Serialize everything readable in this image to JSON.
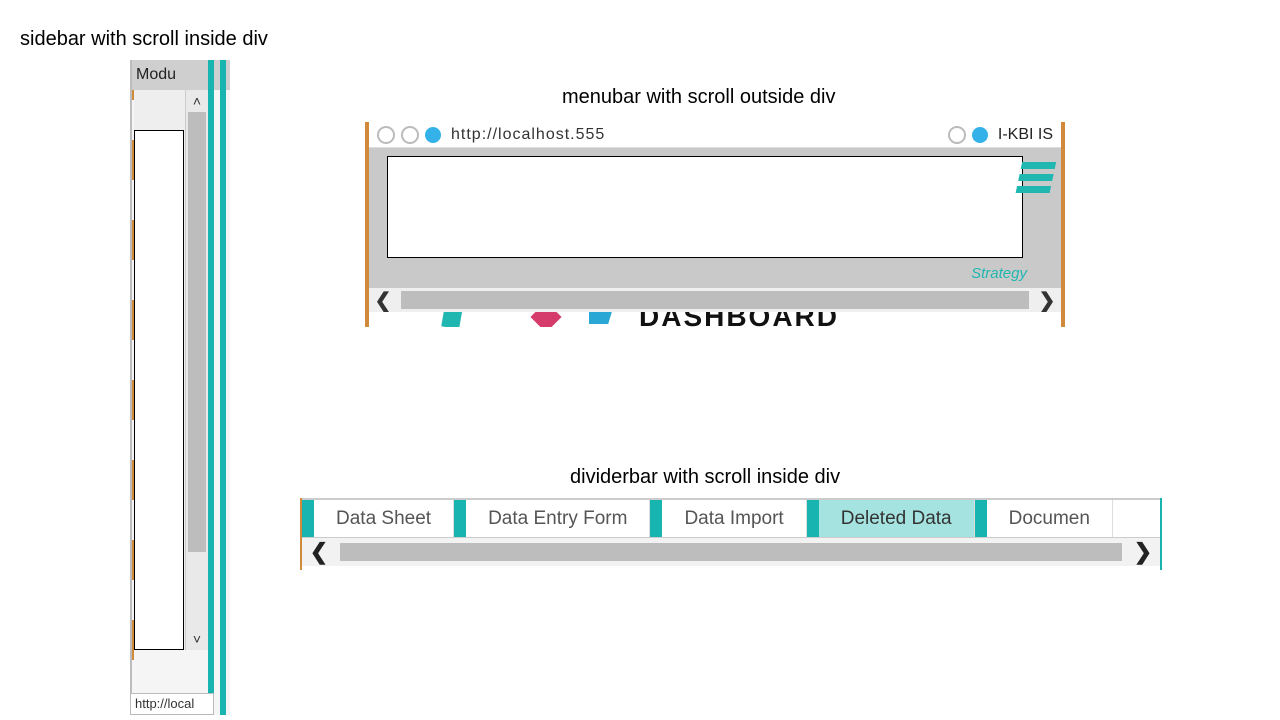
{
  "labels": {
    "sidebar": "sidebar with scroll inside div",
    "menubar": "menubar with scroll outside div",
    "dividerbar": "dividerbar with scroll inside div"
  },
  "sidebar": {
    "header": "Modu",
    "status": "http://local"
  },
  "menubar": {
    "url": "http://localhost.555",
    "tab": "I-KBI IS",
    "caption": "Strategy",
    "dash": "DASHBOARD"
  },
  "dividerbar": {
    "tabs": [
      {
        "label": "Data Sheet",
        "active": false
      },
      {
        "label": "Data Entry Form",
        "active": false
      },
      {
        "label": "Data Import",
        "active": false
      },
      {
        "label": "Deleted Data",
        "active": true
      },
      {
        "label": "Documen",
        "active": false
      }
    ]
  },
  "glyphs": {
    "chev_left": "❮",
    "chev_right": "❯",
    "chev_up": "˄",
    "chev_down": "˅"
  }
}
